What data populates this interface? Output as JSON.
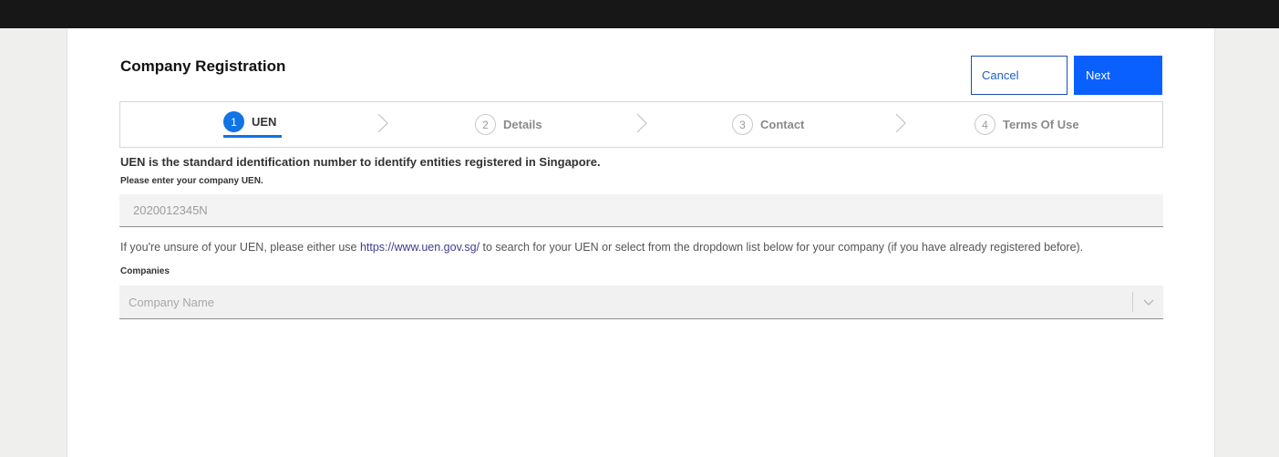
{
  "header": {
    "title": "Company Registration",
    "cancel_label": "Cancel",
    "next_label": "Next"
  },
  "steps": [
    {
      "num": "1",
      "label": "UEN",
      "active": true
    },
    {
      "num": "2",
      "label": "Details",
      "active": false
    },
    {
      "num": "3",
      "label": "Contact",
      "active": false
    },
    {
      "num": "4",
      "label": "Terms Of Use",
      "active": false
    }
  ],
  "form": {
    "description": "UEN is the standard identification number to identify entities registered in Singapore.",
    "uen_label": "Please enter your company UEN.",
    "uen_placeholder": "2020012345N",
    "info_before": "If you're unsure of your UEN, please either use ",
    "info_link": "https://www.uen.gov.sg/",
    "info_after": " to search for your UEN or select from the dropdown list below for your company (if you have already registered before).",
    "companies_label": "Companies",
    "companies_placeholder": "Company Name"
  },
  "colors": {
    "accent": "#0a60ff",
    "step_active": "#1173e6",
    "topbar": "#171717"
  },
  "icons": {
    "step_separator": "chevron-right-icon",
    "dropdown": "chevron-down-icon"
  }
}
